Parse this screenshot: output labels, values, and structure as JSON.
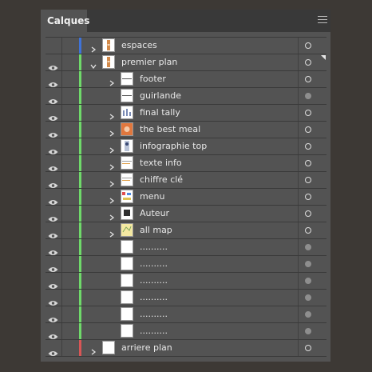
{
  "panel": {
    "tab_label": "Calques"
  },
  "colors": {
    "blue": "#3f73d8",
    "green": "#6fd96a",
    "red": "#d85656"
  },
  "layers": [
    {
      "name": "espaces",
      "level": 0,
      "expanded": false,
      "chevron": true,
      "visible": false,
      "color": "blue",
      "target": "hollow",
      "thumb": "tall-orange"
    },
    {
      "name": "premier plan",
      "level": 0,
      "expanded": true,
      "chevron": true,
      "visible": true,
      "color": "green",
      "target": "hollow",
      "thumb": "tall-orange"
    },
    {
      "name": "footer",
      "level": 1,
      "chevron": true,
      "visible": true,
      "color": "green",
      "target": "hollow",
      "thumb": "line"
    },
    {
      "name": "guirlande",
      "level": 1,
      "chevron": false,
      "visible": true,
      "color": "green",
      "target": "filled",
      "thumb": "line"
    },
    {
      "name": "final tally",
      "level": 1,
      "chevron": true,
      "visible": true,
      "color": "green",
      "target": "hollow",
      "thumb": "chart"
    },
    {
      "name": "the best meal",
      "level": 1,
      "chevron": true,
      "visible": true,
      "color": "green",
      "target": "hollow",
      "thumb": "orange-square"
    },
    {
      "name": "infographie top",
      "level": 1,
      "chevron": true,
      "visible": true,
      "color": "green",
      "target": "hollow",
      "thumb": "figure"
    },
    {
      "name": "texte info",
      "level": 1,
      "chevron": true,
      "visible": true,
      "color": "green",
      "target": "hollow",
      "thumb": "lines"
    },
    {
      "name": "chiffre clé",
      "level": 1,
      "chevron": true,
      "visible": true,
      "color": "green",
      "target": "hollow",
      "thumb": "lines"
    },
    {
      "name": "menu",
      "level": 1,
      "chevron": true,
      "visible": true,
      "color": "green",
      "target": "hollow",
      "thumb": "colorful"
    },
    {
      "name": "Auteur",
      "level": 1,
      "chevron": true,
      "visible": true,
      "color": "green",
      "target": "hollow",
      "thumb": "dark"
    },
    {
      "name": "all map",
      "level": 1,
      "chevron": true,
      "visible": true,
      "color": "green",
      "target": "hollow",
      "thumb": "map"
    },
    {
      "name": "..........",
      "level": 1,
      "chevron": false,
      "visible": true,
      "color": "green",
      "target": "filled",
      "thumb": "blank"
    },
    {
      "name": "..........",
      "level": 1,
      "chevron": false,
      "visible": true,
      "color": "green",
      "target": "filled",
      "thumb": "blank"
    },
    {
      "name": "..........",
      "level": 1,
      "chevron": false,
      "visible": true,
      "color": "green",
      "target": "filled",
      "thumb": "blank"
    },
    {
      "name": "..........",
      "level": 1,
      "chevron": false,
      "visible": true,
      "color": "green",
      "target": "filled",
      "thumb": "blank"
    },
    {
      "name": "..........",
      "level": 1,
      "chevron": false,
      "visible": true,
      "color": "green",
      "target": "filled",
      "thumb": "blank"
    },
    {
      "name": "..........",
      "level": 1,
      "chevron": false,
      "visible": true,
      "color": "green",
      "target": "filled",
      "thumb": "blank"
    },
    {
      "name": "arriere plan",
      "level": 0,
      "expanded": false,
      "chevron": true,
      "visible": true,
      "color": "red",
      "target": "hollow",
      "thumb": "white"
    }
  ]
}
